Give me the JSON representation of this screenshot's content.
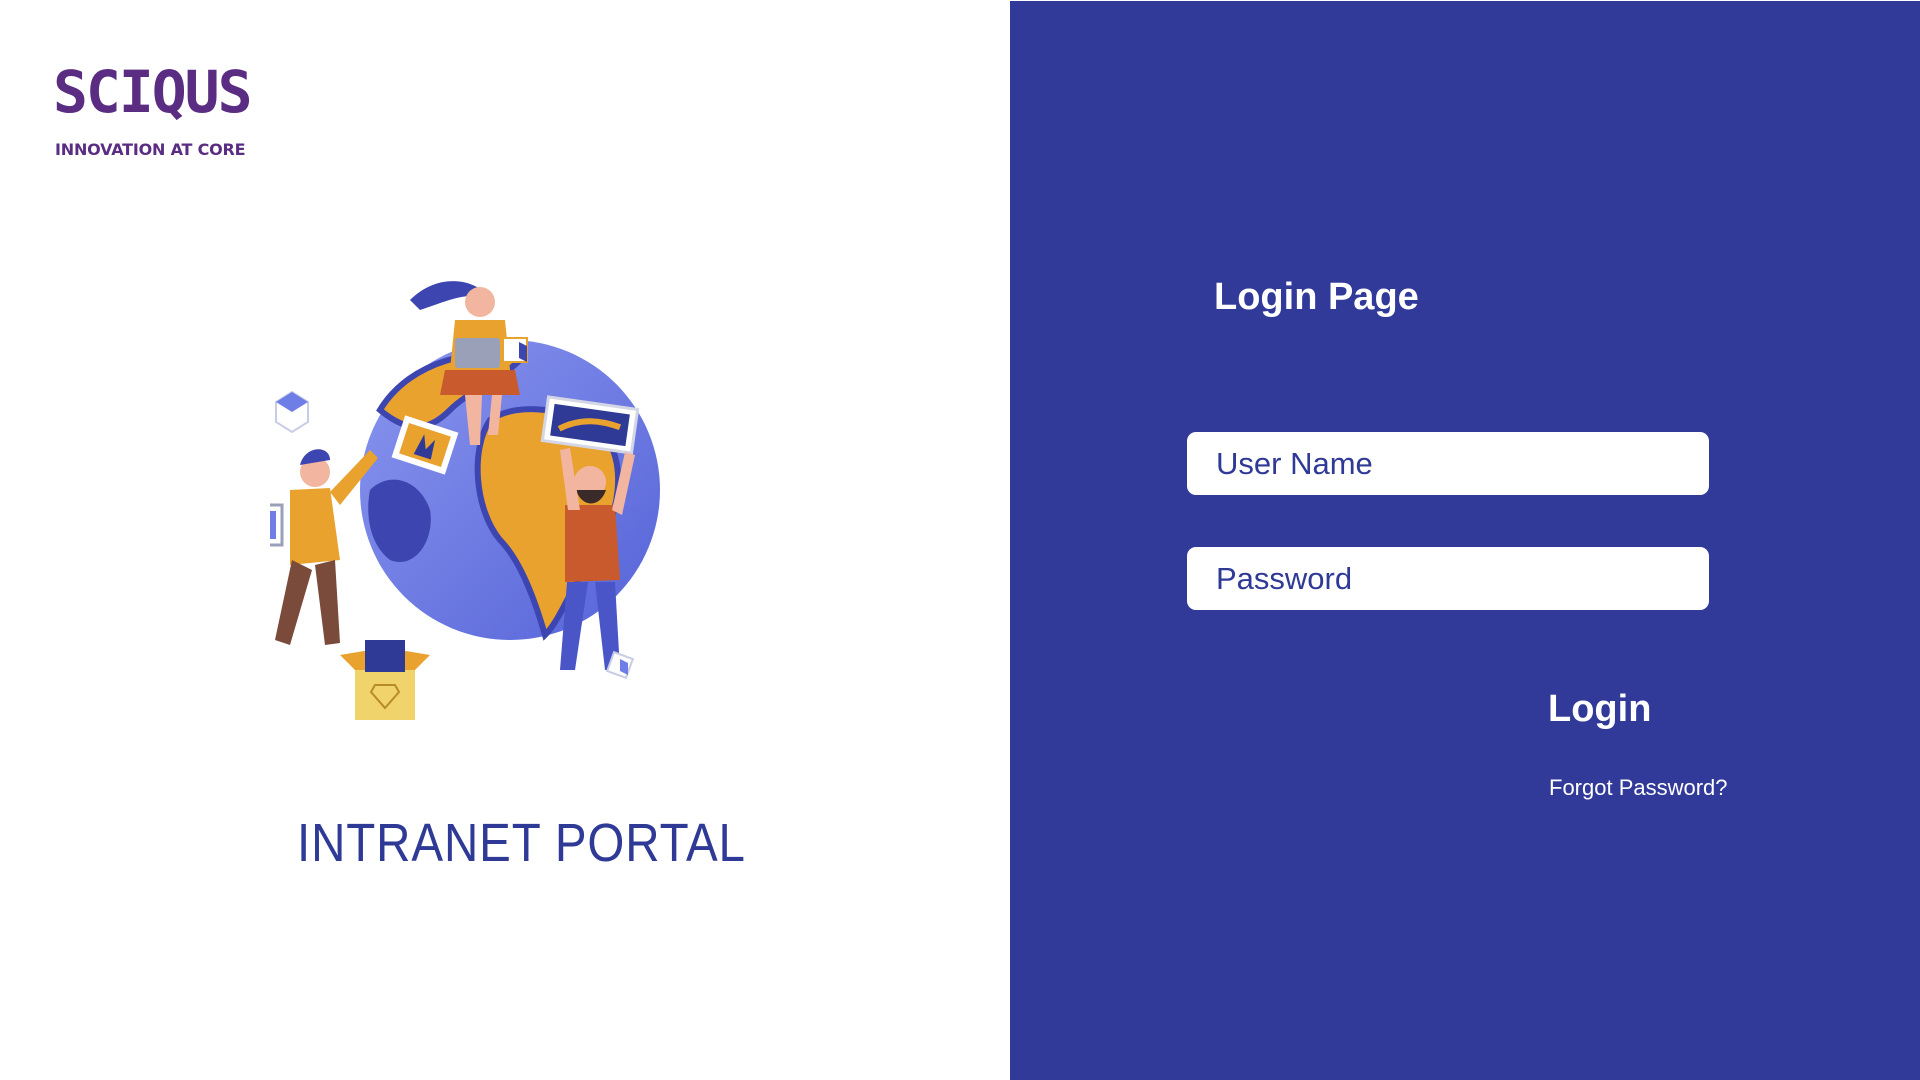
{
  "brand": {
    "name": "SCIQUS",
    "tagline": "INNOVATION AT CORE",
    "color": "#5a2d82"
  },
  "portal": {
    "title": "INTRANET PORTAL",
    "illustration_icon": "globe-people-illustration"
  },
  "login": {
    "heading": "Login Page",
    "username_placeholder": "User Name",
    "username_value": "",
    "password_placeholder": "Password",
    "password_value": "",
    "submit_label": "Login",
    "forgot_label": "Forgot Password?"
  },
  "colors": {
    "panel_bg": "#313a99",
    "accent_text": "#2f3a96",
    "globe_blue": "#6f7ee6",
    "continent_orange": "#eaa22f"
  }
}
